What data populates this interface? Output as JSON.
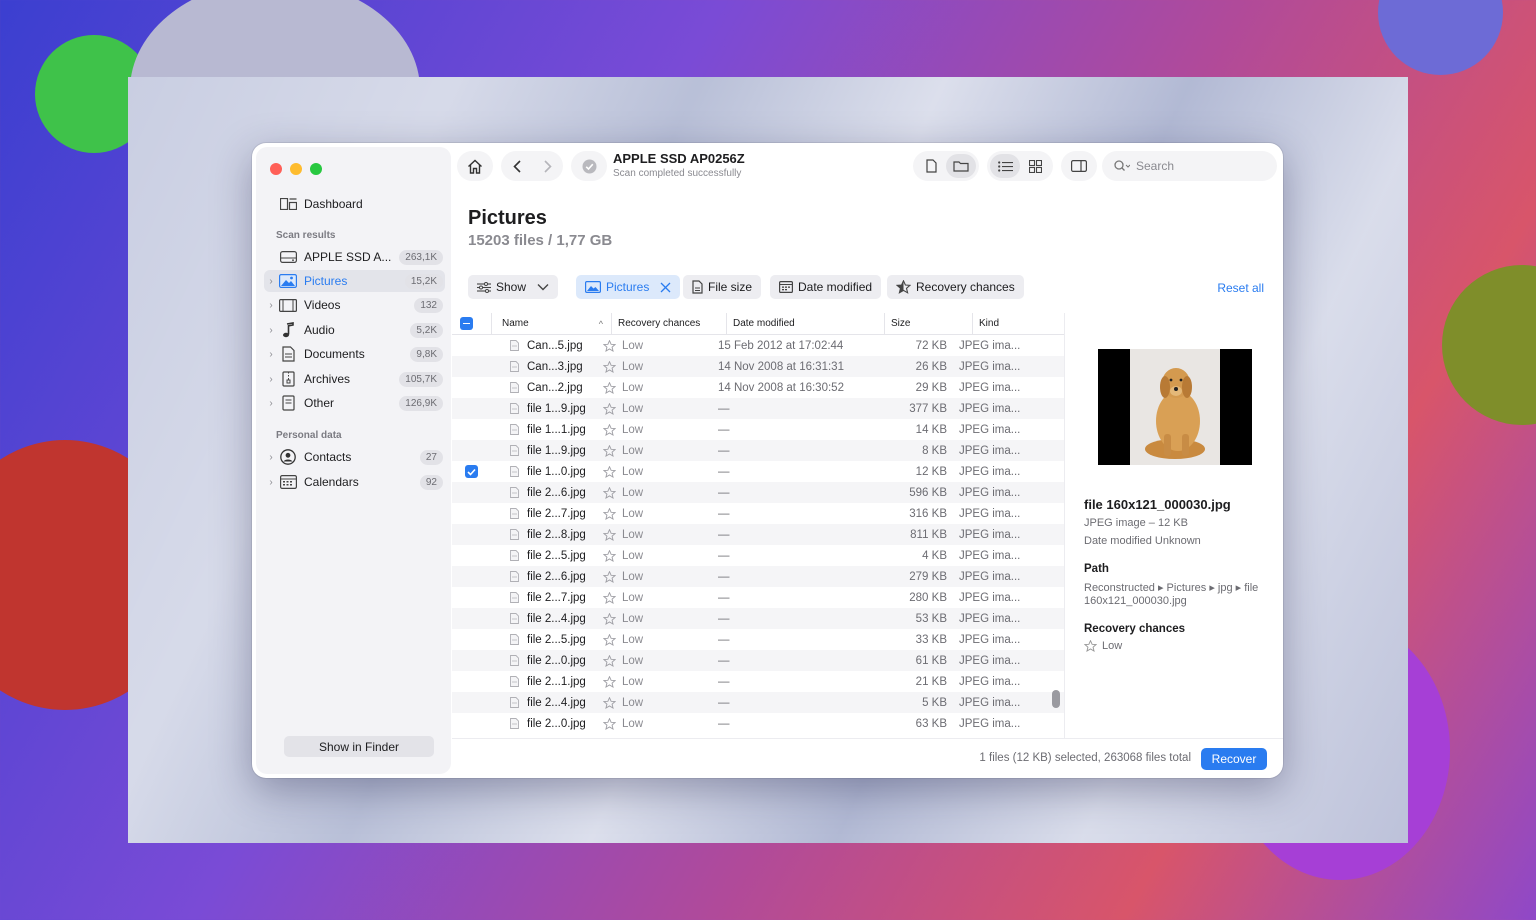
{
  "colors": {
    "accent": "#2a7cf0",
    "close": "#ff5f57",
    "minimize": "#febc2e",
    "zoom": "#28c840"
  },
  "toolbar": {
    "disk_title": "APPLE SSD AP0256Z",
    "disk_subtitle": "Scan completed successfully",
    "search_placeholder": "Search"
  },
  "sidebar": {
    "dashboard": "Dashboard",
    "scan_results_label": "Scan results",
    "scan_items": [
      {
        "label": "APPLE SSD A...",
        "count": "263,1K",
        "icon": "disk-icon"
      },
      {
        "label": "Pictures",
        "count": "15,2K",
        "icon": "pictures-icon"
      },
      {
        "label": "Videos",
        "count": "132",
        "icon": "film-icon"
      },
      {
        "label": "Audio",
        "count": "5,2K",
        "icon": "music-note-icon"
      },
      {
        "label": "Documents",
        "count": "9,8K",
        "icon": "document-icon"
      },
      {
        "label": "Archives",
        "count": "105,7K",
        "icon": "archive-icon"
      },
      {
        "label": "Other",
        "count": "126,9K",
        "icon": "other-file-icon"
      }
    ],
    "personal_label": "Personal data",
    "personal_items": [
      {
        "label": "Contacts",
        "count": "27",
        "icon": "contact-icon"
      },
      {
        "label": "Calendars",
        "count": "92",
        "icon": "calendar-icon"
      }
    ],
    "show_in_finder": "Show in Finder"
  },
  "main": {
    "title": "Pictures",
    "subtitle": "15203 files / 1,77 GB",
    "filters": {
      "show": "Show",
      "pictures": "Pictures",
      "file_size": "File size",
      "date_modified": "Date modified",
      "recovery_chances": "Recovery chances",
      "reset_all": "Reset all"
    },
    "columns": {
      "name": "Name",
      "recovery": "Recovery chances",
      "date": "Date modified",
      "size": "Size",
      "kind": "Kind"
    },
    "rows": [
      {
        "name": "Can...5.jpg",
        "chance": "Low",
        "date": "15 Feb 2012 at 17:02:44",
        "size": "72 KB",
        "kind": "JPEG ima..."
      },
      {
        "name": "Can...3.jpg",
        "chance": "Low",
        "date": "14 Nov 2008 at 16:31:31",
        "size": "26 KB",
        "kind": "JPEG ima..."
      },
      {
        "name": "Can...2.jpg",
        "chance": "Low",
        "date": "14 Nov 2008 at 16:30:52",
        "size": "29 KB",
        "kind": "JPEG ima..."
      },
      {
        "name": "file 1...9.jpg",
        "chance": "Low",
        "date": "—",
        "size": "377 KB",
        "kind": "JPEG ima..."
      },
      {
        "name": "file 1...1.jpg",
        "chance": "Low",
        "date": "—",
        "size": "14 KB",
        "kind": "JPEG ima..."
      },
      {
        "name": "file 1...9.jpg",
        "chance": "Low",
        "date": "—",
        "size": "8 KB",
        "kind": "JPEG ima..."
      },
      {
        "name": "file 1...0.jpg",
        "chance": "Low",
        "date": "—",
        "size": "12 KB",
        "kind": "JPEG ima...",
        "checked": true
      },
      {
        "name": "file 2...6.jpg",
        "chance": "Low",
        "date": "—",
        "size": "596 KB",
        "kind": "JPEG ima..."
      },
      {
        "name": "file 2...7.jpg",
        "chance": "Low",
        "date": "—",
        "size": "316 KB",
        "kind": "JPEG ima..."
      },
      {
        "name": "file 2...8.jpg",
        "chance": "Low",
        "date": "—",
        "size": "811 KB",
        "kind": "JPEG ima..."
      },
      {
        "name": "file 2...5.jpg",
        "chance": "Low",
        "date": "—",
        "size": "4 KB",
        "kind": "JPEG ima..."
      },
      {
        "name": "file 2...6.jpg",
        "chance": "Low",
        "date": "—",
        "size": "279 KB",
        "kind": "JPEG ima..."
      },
      {
        "name": "file 2...7.jpg",
        "chance": "Low",
        "date": "—",
        "size": "280 KB",
        "kind": "JPEG ima..."
      },
      {
        "name": "file 2...4.jpg",
        "chance": "Low",
        "date": "—",
        "size": "53 KB",
        "kind": "JPEG ima..."
      },
      {
        "name": "file 2...5.jpg",
        "chance": "Low",
        "date": "—",
        "size": "33 KB",
        "kind": "JPEG ima..."
      },
      {
        "name": "file 2...0.jpg",
        "chance": "Low",
        "date": "—",
        "size": "61 KB",
        "kind": "JPEG ima..."
      },
      {
        "name": "file 2...1.jpg",
        "chance": "Low",
        "date": "—",
        "size": "21 KB",
        "kind": "JPEG ima..."
      },
      {
        "name": "file 2...4.jpg",
        "chance": "Low",
        "date": "—",
        "size": "5 KB",
        "kind": "JPEG ima..."
      },
      {
        "name": "file 2...0.jpg",
        "chance": "Low",
        "date": "—",
        "size": "63 KB",
        "kind": "JPEG ima..."
      }
    ]
  },
  "preview": {
    "file_name": "file 160x121_000030.jpg",
    "type_size": "JPEG image – 12 KB",
    "date_modified": "Date modified  Unknown",
    "path_label": "Path",
    "path_line1": "Reconstructed ▸ Pictures ▸ jpg ▸ file",
    "path_line2": "160x121_000030.jpg",
    "recovery_label": "Recovery chances",
    "recovery_value": "Low"
  },
  "footer": {
    "status": "1 files (12 KB) selected, 263068 files total",
    "recover": "Recover"
  }
}
